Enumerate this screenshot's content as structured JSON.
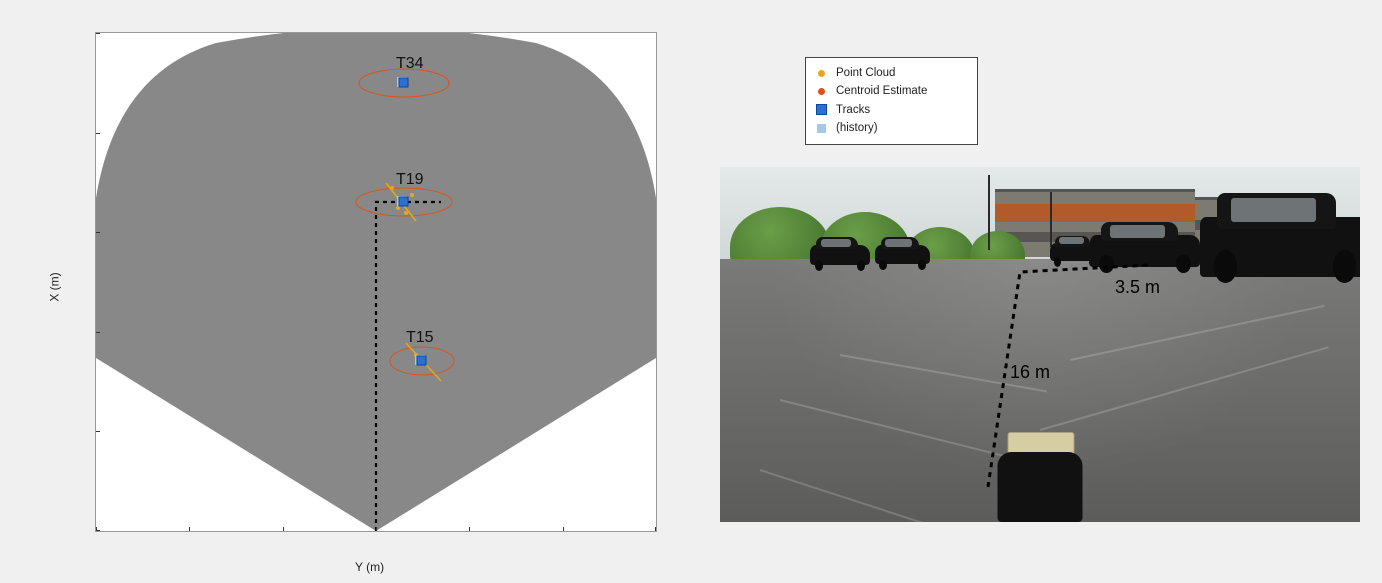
{
  "chart_data": {
    "type": "scatter",
    "title": "",
    "xlabel": "Y (m)",
    "ylabel": "X (m)",
    "xlim": [
      15,
      -15
    ],
    "ylim": [
      0,
      25
    ],
    "x_ticks": [
      15,
      10,
      5,
      0,
      -5,
      -10,
      -15
    ],
    "y_ticks": [
      0,
      5,
      10,
      15,
      20,
      25
    ],
    "fov_sector": {
      "radius_m": 25,
      "center": [
        0,
        0
      ],
      "half_angle_deg": 60
    },
    "tracks": [
      {
        "id": "T34",
        "x_m": 22.5,
        "y_m": -1.5,
        "ellipse_rx": 3.0,
        "ellipse_ry": 1.0
      },
      {
        "id": "T19",
        "x_m": 16.5,
        "y_m": -1.5,
        "ellipse_rx": 3.0,
        "ellipse_ry": 1.0
      },
      {
        "id": "T15",
        "x_m": 8.5,
        "y_m": -2.5,
        "ellipse_rx": 2.0,
        "ellipse_ry": 1.0
      }
    ],
    "path_vertices_xy": [
      [
        0,
        0
      ],
      [
        16.5,
        0
      ],
      [
        16.5,
        -3.5
      ]
    ]
  },
  "legend": {
    "pointcloud": "Point Cloud",
    "centroid": "Centroid Estimate",
    "tracks": "Tracks",
    "history": "(history)"
  },
  "photo_annotations": {
    "dist_along": "16 m",
    "dist_across": "3.5 m"
  },
  "colors": {
    "pointcloud": "#e6a817",
    "centroid": "#d9531e",
    "track": "#2e6fd1",
    "history": "#a4c8e6",
    "fov": "#888888"
  }
}
